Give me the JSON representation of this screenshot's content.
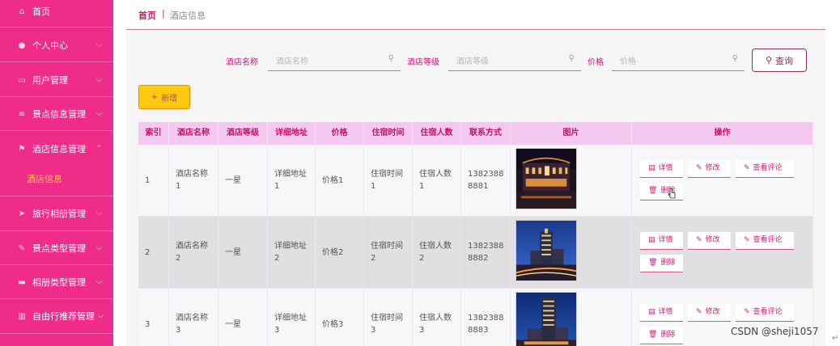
{
  "sidebar": {
    "items": [
      {
        "label": "首页",
        "icon": "home-icon"
      },
      {
        "label": "个人中心",
        "icon": "user-icon"
      },
      {
        "label": "用户管理",
        "icon": "chat-icon"
      },
      {
        "label": "景点信息管理",
        "icon": "list-icon"
      },
      {
        "label": "酒店信息管理",
        "icon": "flag-icon"
      },
      {
        "label": "旅行相册管理",
        "icon": "send-icon"
      },
      {
        "label": "景点类型管理",
        "icon": "brush-icon"
      },
      {
        "label": "相册类型管理",
        "icon": "box-icon"
      },
      {
        "label": "自由行推荐管理",
        "icon": "bar-chart-icon"
      }
    ],
    "sub_item": "酒店信息"
  },
  "breadcrumb": {
    "home": "首页",
    "separator": "|",
    "current": "酒店信息"
  },
  "search": {
    "hotel_name_label": "酒店名称",
    "hotel_name_placeholder": "酒店名称",
    "hotel_level_label": "酒店等级",
    "hotel_level_placeholder": "酒店等级",
    "price_label": "价格",
    "price_placeholder": "价格",
    "search_button": "查询"
  },
  "toolbar": {
    "add_button": "新增",
    "add_symbol": "+"
  },
  "table": {
    "headers": [
      "索引",
      "酒店名称",
      "酒店等级",
      "详细地址",
      "价格",
      "住宿时间",
      "住宿人数",
      "联系方式",
      "图片",
      "操作"
    ],
    "rows": [
      {
        "index": "1",
        "name": "酒店名称\n1",
        "level": "一星",
        "address": "详细地址\n1",
        "price": "价格1",
        "stay_time": "住宿时间\n1",
        "guests": "住宿人数\n1",
        "contact": "1382388\n8881",
        "photo": "night hotel facade"
      },
      {
        "index": "2",
        "name": "酒店名称\n2",
        "level": "一星",
        "address": "详细地址\n2",
        "price": "价格2",
        "stay_time": "住宿时间\n2",
        "guests": "住宿人数\n2",
        "contact": "1382388\n8882",
        "photo": "tower hotel at dusk"
      },
      {
        "index": "3",
        "name": "酒店名称\n3",
        "level": "一星",
        "address": "详细地址\n3",
        "price": "价格3",
        "stay_time": "住宿时间\n3",
        "guests": "住宿人数\n3",
        "contact": "1382388\n8883",
        "photo": "hotel tower at night"
      }
    ],
    "actions": {
      "detail": "详情",
      "edit": "修改",
      "comments": "查看评论",
      "delete": "删除"
    }
  },
  "colors": {
    "sidebar": "#f02c8b",
    "accent": "#c1136d",
    "header_bg": "#f5c8f0",
    "new_button": "#ffc90f"
  },
  "watermark": "CSDN @sheji1057"
}
